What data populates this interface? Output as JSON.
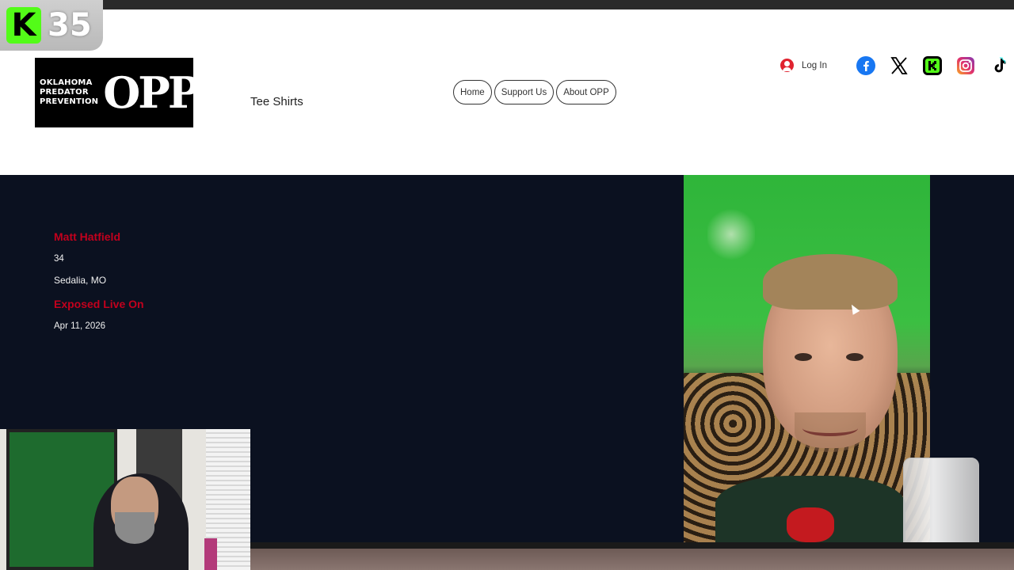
{
  "overlay": {
    "kick_count": "35",
    "kick_letter": "K"
  },
  "header": {
    "logo_lines": [
      "Oklahoma",
      "Predator",
      "Prevention"
    ],
    "logo_mark": "OPP",
    "tee_shirts": "Tee Shirts",
    "nav": [
      {
        "label": "Home"
      },
      {
        "label": "Support Us"
      },
      {
        "label": "About OPP"
      }
    ],
    "login_label": "Log In",
    "social_icons": [
      "facebook-icon",
      "x-icon",
      "kick-icon",
      "instagram-icon",
      "tiktok-icon"
    ]
  },
  "profile": {
    "name": "Matt Hatfield",
    "age": "34",
    "location": "Sedalia, MO",
    "exposed_label": "Exposed Live On",
    "date": "Apr 11, 2026"
  },
  "colors": {
    "panel_bg": "#0b1120",
    "accent_red": "#c2001d",
    "kick_green": "#53fc18"
  }
}
